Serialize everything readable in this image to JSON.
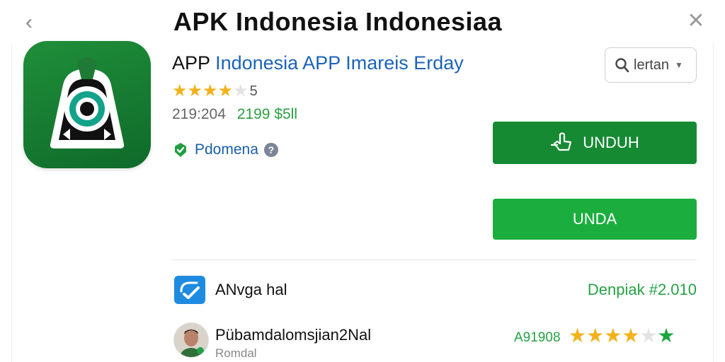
{
  "header": {
    "back_icon": "chevron-left-icon",
    "title": "APK Indonesia Indonesiaa",
    "close_icon": "close-icon"
  },
  "app": {
    "name_prefix": "APP",
    "name_rest": "Indonesia APP Imareis Erday",
    "rating_stars": 4,
    "rating_max": "5",
    "stats_left": "219:204",
    "stats_right": "2199 $5ll",
    "developer_name": "Pdomena",
    "help_glyph": "?"
  },
  "search": {
    "label": "lertan",
    "icon": "search-icon"
  },
  "buttons": {
    "primary_label": "UNDUH",
    "secondary_label": "UNDA",
    "primary_icon": "download-hand-icon"
  },
  "section": {
    "title": "ANvga hal",
    "meta": "Denpiak #2.010"
  },
  "review": {
    "name": "Pübamdalomsjian2Nal",
    "sub": "Romdal",
    "score": "A91908",
    "stars": 4
  },
  "colors": {
    "primary_green": "#158a33",
    "secondary_green": "#1bae3f",
    "link_blue": "#1c63b8",
    "star_gold": "#f2b21b"
  }
}
